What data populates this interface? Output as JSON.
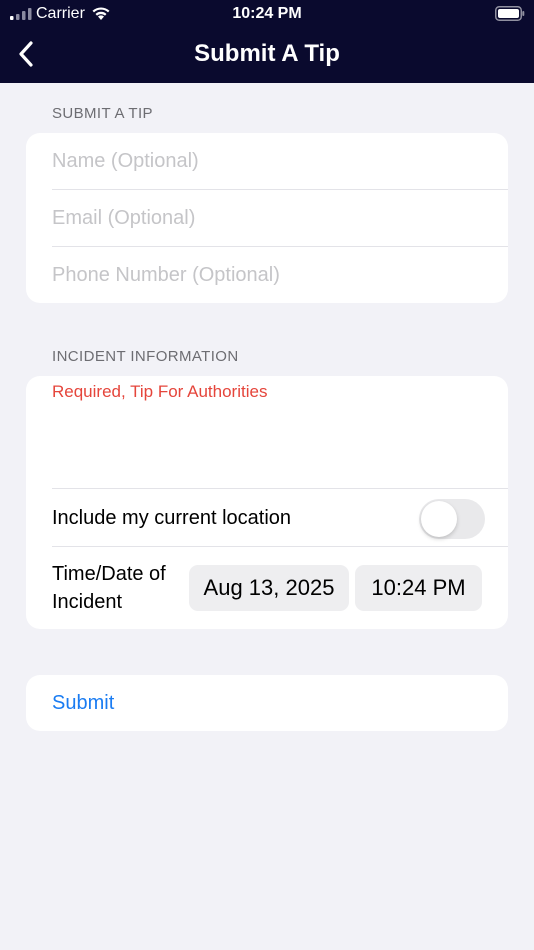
{
  "status_bar": {
    "carrier": "Carrier",
    "time": "10:24 PM",
    "icons": [
      "signal-icon",
      "wifi-icon",
      "battery-icon"
    ]
  },
  "nav": {
    "title": "Submit A Tip",
    "back_icon": "chevron-left-icon",
    "background": "#0a0a2e"
  },
  "contact_section": {
    "header": "SUBMIT A TIP",
    "fields": [
      {
        "placeholder": "Name (Optional)",
        "value": ""
      },
      {
        "placeholder": "Email (Optional)",
        "value": ""
      },
      {
        "placeholder": "Phone Number (Optional)",
        "value": ""
      }
    ]
  },
  "incident_section": {
    "header": "INCIDENT INFORMATION",
    "tip_placeholder": "Required, Tip For Authorities",
    "location_label": "Include my current location",
    "location_enabled": false,
    "datetime_label": "Time/Date of Incident",
    "date_value": "Aug 13, 2025",
    "time_value": "10:24 PM"
  },
  "submit": {
    "label": "Submit"
  },
  "colors": {
    "accent": "#1a7cf2",
    "required": "#e5453b",
    "background": "#f2f2f7"
  }
}
